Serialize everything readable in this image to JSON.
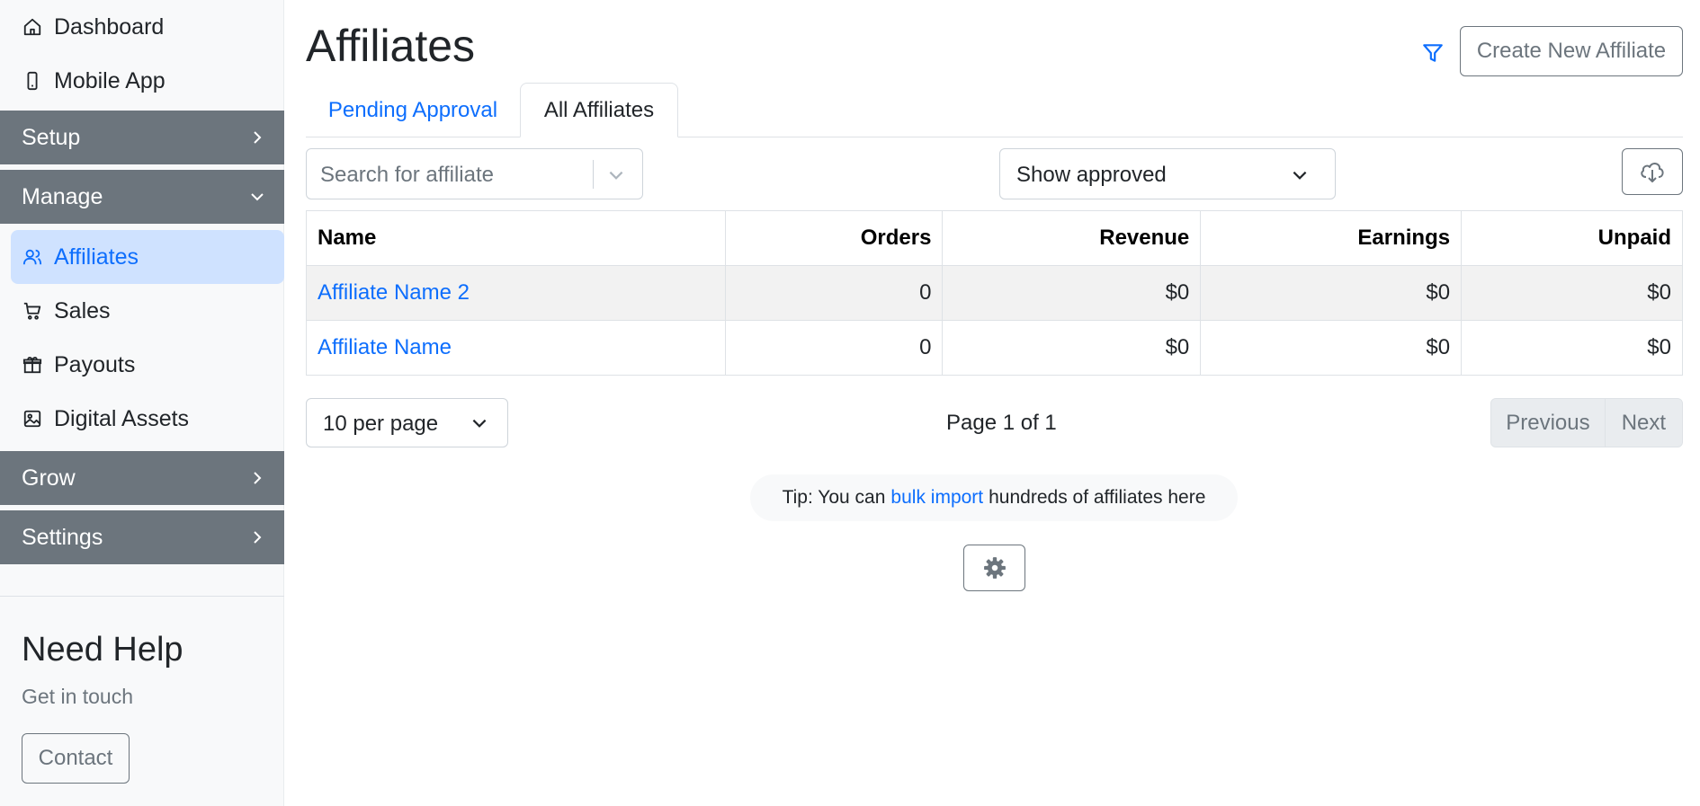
{
  "sidebar": {
    "top_items": [
      {
        "label": "Dashboard",
        "icon": "home-icon"
      },
      {
        "label": "Mobile App",
        "icon": "phone-icon"
      }
    ],
    "sections": {
      "setup": "Setup",
      "manage": "Manage",
      "grow": "Grow",
      "settings": "Settings"
    },
    "manage_items": [
      {
        "label": "Affiliates",
        "icon": "users-icon",
        "active": true
      },
      {
        "label": "Sales",
        "icon": "cart-icon"
      },
      {
        "label": "Payouts",
        "icon": "gift-icon"
      },
      {
        "label": "Digital Assets",
        "icon": "image-icon"
      }
    ],
    "help": {
      "title": "Need Help",
      "subtitle": "Get in touch",
      "contact_label": "Contact"
    }
  },
  "header": {
    "title": "Affiliates",
    "create_label": "Create New Affiliate"
  },
  "tabs": {
    "pending": "Pending Approval",
    "all": "All Affiliates",
    "active": "all"
  },
  "filters": {
    "search_placeholder": "Search for affiliate",
    "status_value": "Show approved"
  },
  "table": {
    "headers": {
      "name": "Name",
      "orders": "Orders",
      "revenue": "Revenue",
      "earnings": "Earnings",
      "unpaid": "Unpaid"
    },
    "rows": [
      {
        "name": "Affiliate Name 2",
        "orders": "0",
        "revenue": "$0",
        "earnings": "$0",
        "unpaid": "$0"
      },
      {
        "name": "Affiliate Name",
        "orders": "0",
        "revenue": "$0",
        "earnings": "$0",
        "unpaid": "$0"
      }
    ]
  },
  "pagination": {
    "per_page": "10 per page",
    "page_info": "Page 1 of 1",
    "previous": "Previous",
    "next": "Next"
  },
  "tip": {
    "prefix": "Tip: You can",
    "link": "bulk import",
    "suffix": "hundreds of affiliates here"
  },
  "colors": {
    "accent": "#0d6efd",
    "section_bg": "#6c757d",
    "active_bg": "#cfe2ff"
  }
}
